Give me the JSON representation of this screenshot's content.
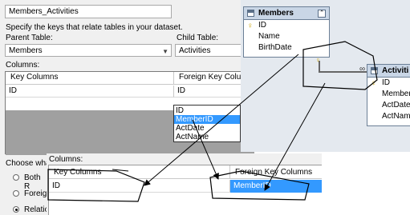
{
  "dialog": {
    "relation_name": "Members_Activities",
    "instruction": "Specify the keys that relate tables in your dataset.",
    "parent_table_label": "Parent Table:",
    "parent_table_value": "Members",
    "child_table_label": "Child Table:",
    "child_table_value": "Activities",
    "columns_label": "Columns:",
    "key_columns_header": "Key Columns",
    "foreign_key_columns_header": "Foreign Key Colum",
    "key_cell": "ID",
    "foreign_key_cell": "ID",
    "dropdown_items": [
      "ID",
      "MemberID",
      "ActDate",
      "ActName"
    ],
    "dropdown_selected_index": 1,
    "choose_label": "Choose wha",
    "radio_both": "Both R",
    "radio_foreign": "Foreig",
    "radio_relation_only": "Relation Only"
  },
  "diagram": {
    "members_table": {
      "title": "Members",
      "collapse_glyph": "⌃",
      "columns": [
        "ID",
        "Name",
        "BirthDate"
      ]
    },
    "activities_table": {
      "title": "Activiti",
      "columns": [
        "ID",
        "MemberI",
        "ActDate",
        "ActName"
      ]
    },
    "connector_glyph": "∞"
  },
  "zoom": {
    "columns_label": "Columns:",
    "key_columns_header": "Key Columns",
    "foreign_key_columns_header": "Foreign Key Columns",
    "key_cell": "ID",
    "foreign_key_cell": "MemberID"
  },
  "colors": {
    "selection": "#3399ff",
    "diagram_bg": "#e4e9ef",
    "table_header": "#c9d6e6",
    "grid_empty": "#a0a0a0"
  }
}
